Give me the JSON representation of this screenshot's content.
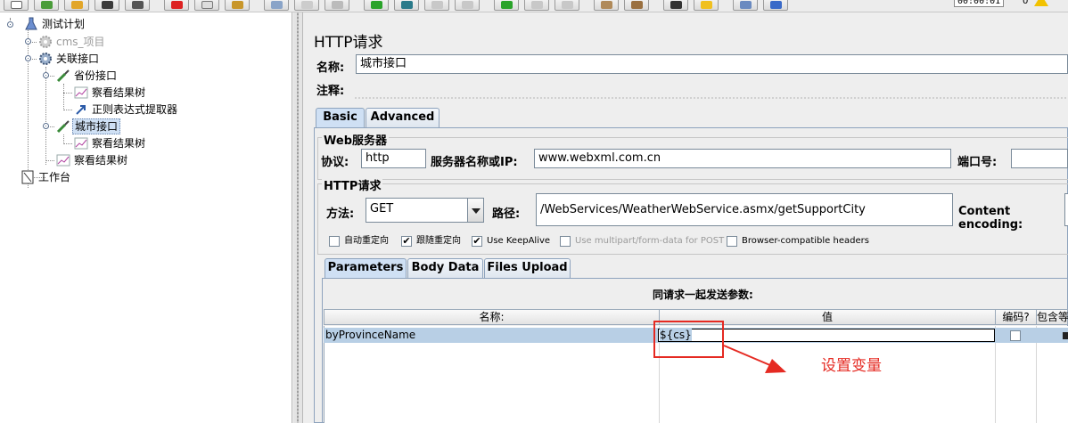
{
  "toolbar": {
    "timer": "00:00:01",
    "warning_count": "0"
  },
  "tree": {
    "test_plan": "测试计划",
    "cms_project": "cms_项目",
    "association_controller": "关联接口",
    "province_sampler": "省份接口",
    "province_result_tree": "察看结果树",
    "regex_extractor": "正则表达式提取器",
    "city_sampler": "城市接口",
    "city_result_tree": "察看结果树",
    "controller_result_tree": "察看结果树",
    "workbench": "工作台"
  },
  "panel": {
    "title": "HTTP请求",
    "name_label": "名称:",
    "name_value": "城市接口",
    "comment_label": "注释:",
    "tabs": {
      "basic": "Basic",
      "advanced": "Advanced"
    },
    "web_server": {
      "legend": "Web服务器",
      "protocol_label": "协议:",
      "protocol_value": "http",
      "server_label": "服务器名称或IP:",
      "server_value": "www.webxml.com.cn",
      "port_label": "端口号:",
      "port_value": ""
    },
    "http_request": {
      "legend": "HTTP请求",
      "method_label": "方法:",
      "method_value": "GET",
      "path_label": "路径:",
      "path_value": "/WebServices/WeatherWebService.asmx/getSupportCity",
      "encoding_label": "Content encoding:"
    },
    "checkboxes": [
      {
        "label": "自动重定向",
        "checked": false
      },
      {
        "label": "跟随重定向",
        "checked": true
      },
      {
        "label": "Use KeepAlive",
        "checked": true
      },
      {
        "label": "Use multipart/form-data for POST",
        "checked": false
      },
      {
        "label": "Browser-compatible headers",
        "checked": false
      }
    ],
    "subtabs": {
      "parameters": "Parameters",
      "body_data": "Body Data",
      "files_upload": "Files Upload"
    },
    "params": {
      "caption": "同请求一起发送参数:",
      "col_name": "名称:",
      "col_value": "值",
      "col_encode": "编码?",
      "col_include": "包含等",
      "rows": [
        {
          "name": "byProvinceName",
          "value": "${cs}"
        }
      ]
    }
  },
  "annotation": {
    "text": "设置变量",
    "color": "#e52a22"
  },
  "colors": {
    "selection": "#b8cfe5",
    "tab_active": "#cfe0f4",
    "panel_bg": "#eeeeee"
  }
}
